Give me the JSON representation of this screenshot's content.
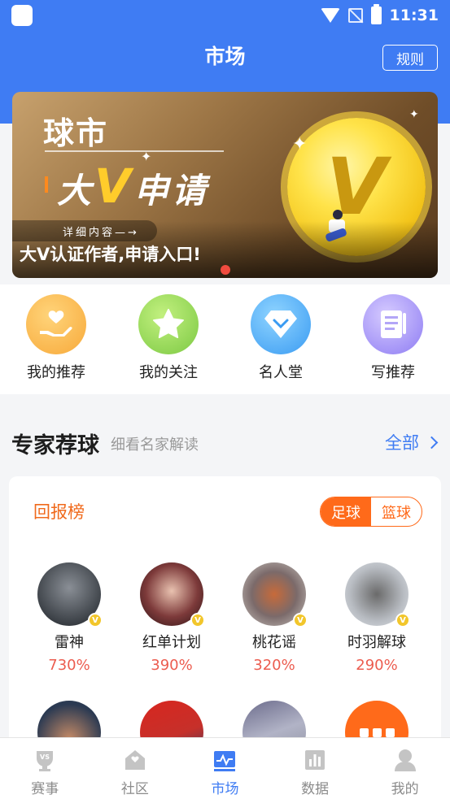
{
  "status": {
    "time": "11:31"
  },
  "header": {
    "title": "市场",
    "rules_button": "规则"
  },
  "banner": {
    "brand": "球市",
    "headline_prefix": "大",
    "headline_v": "V",
    "headline_suffix": "申请",
    "detail_link": "详细内容—→",
    "caption": "大V认证作者,申请入口!",
    "coin_letter": "V"
  },
  "quick_actions": [
    {
      "label": "我的推荐",
      "icon": "hand-heart-icon",
      "color": "#f7a93a"
    },
    {
      "label": "我的关注",
      "icon": "star-icon",
      "color": "#82d14a"
    },
    {
      "label": "名人堂",
      "icon": "diamond-icon",
      "color": "#3ea8f5"
    },
    {
      "label": "写推荐",
      "icon": "document-icon",
      "color": "#8e7cf3"
    }
  ],
  "experts_section": {
    "title": "专家荐球",
    "subtitle": "细看名家解读",
    "all_link": "全部"
  },
  "leaderboard": {
    "title": "回报榜",
    "toggle": {
      "football": "足球",
      "basketball": "篮球",
      "selected": "football"
    },
    "experts": [
      {
        "name": "雷神",
        "return_rate": "730%",
        "verified_badge": "V"
      },
      {
        "name": "红单计划",
        "return_rate": "390%",
        "verified_badge": "V"
      },
      {
        "name": "桃花谣",
        "return_rate": "320%",
        "verified_badge": "V"
      },
      {
        "name": "时羽解球",
        "return_rate": "290%",
        "verified_badge": "V"
      }
    ]
  },
  "tabbar": {
    "items": [
      {
        "label": "赛事",
        "icon": "vs-trophy-icon"
      },
      {
        "label": "社区",
        "icon": "home-icon"
      },
      {
        "label": "市场",
        "icon": "market-chart-icon"
      },
      {
        "label": "数据",
        "icon": "bar-chart-icon"
      },
      {
        "label": "我的",
        "icon": "user-icon"
      }
    ],
    "active": "市场"
  }
}
